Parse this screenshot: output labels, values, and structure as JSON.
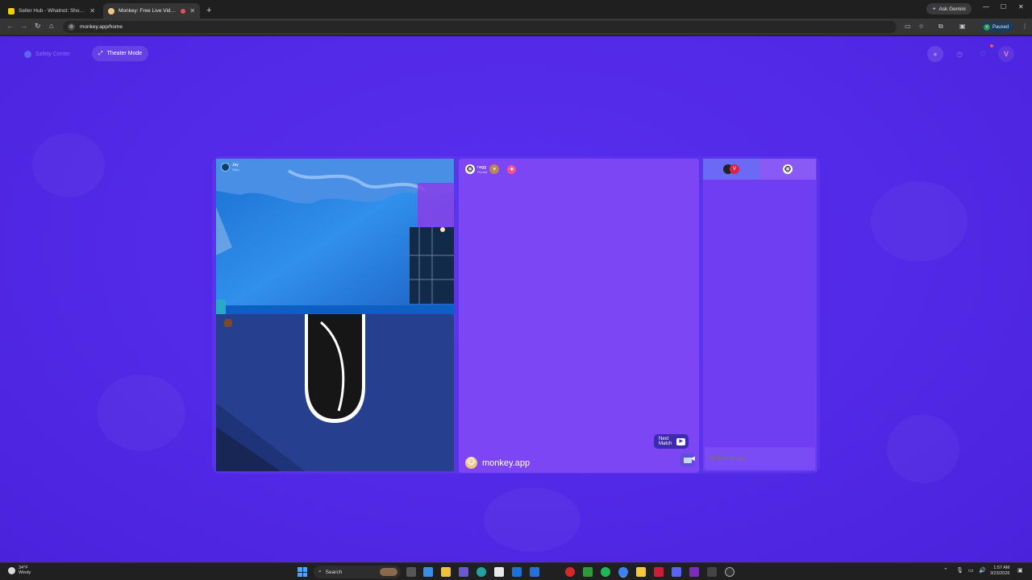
{
  "browser": {
    "tabs": [
      {
        "title": "Seller Hub - Whatnot: Shop, Se",
        "active": false,
        "favicon_color": "#f5d000"
      },
      {
        "title": "Monkey: Free Live Video C",
        "active": true,
        "favicon_color": "#f2c48b"
      }
    ],
    "new_tab": "+",
    "ask_gemini": "Ask Gemini",
    "url": "monkey.app/home",
    "profile_status": "Paused",
    "profile_initial": "V"
  },
  "page": {
    "safety_center": "Safety Center",
    "theater_mode": "Theater Mode",
    "profile_initial": "V",
    "remote_user": {
      "name": "Jay",
      "location": "Ohio"
    },
    "match_user": {
      "name": "nagg",
      "location": "Florida"
    },
    "brand": "monkey.app",
    "next_match": {
      "line1": "Next",
      "line2": "Match"
    },
    "chat_placeholder": "Send Message",
    "chat_avatar_initial": "V"
  },
  "taskbar": {
    "weather_temp": "34°F",
    "weather_desc": "Windy",
    "search_label": "Search",
    "time": "1:57 AM",
    "date": "3/23/2026"
  },
  "colors": {
    "page_bg": "#5229e6",
    "middle_panel": "#7c46f4",
    "chat_panel": "#6f3ef2"
  }
}
